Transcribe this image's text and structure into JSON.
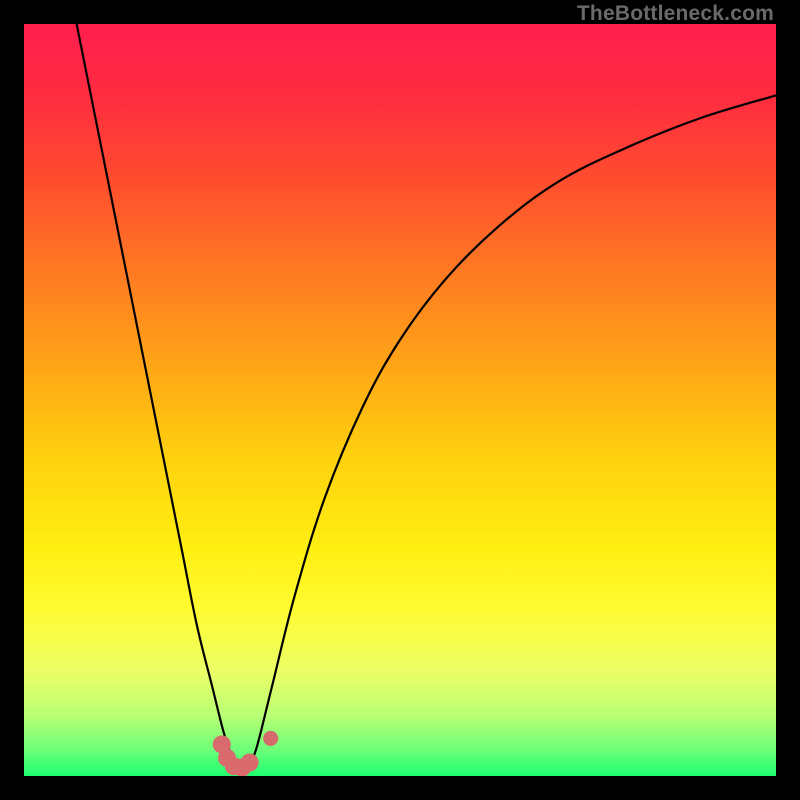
{
  "watermark": "TheBottleneck.com",
  "chart_data": {
    "type": "line",
    "title": "",
    "xlabel": "",
    "ylabel": "",
    "xlim": [
      0,
      100
    ],
    "ylim": [
      0,
      100
    ],
    "grid": false,
    "legend": false,
    "gradient_stops": [
      {
        "offset": 0.0,
        "color": "#ff1f4d"
      },
      {
        "offset": 0.09,
        "color": "#ff2b41"
      },
      {
        "offset": 0.2,
        "color": "#ff4a2f"
      },
      {
        "offset": 0.33,
        "color": "#ff7a22"
      },
      {
        "offset": 0.46,
        "color": "#ffa716"
      },
      {
        "offset": 0.58,
        "color": "#ffd20e"
      },
      {
        "offset": 0.7,
        "color": "#ffef12"
      },
      {
        "offset": 0.78,
        "color": "#fffc33"
      },
      {
        "offset": 0.86,
        "color": "#ecff66"
      },
      {
        "offset": 0.92,
        "color": "#b8ff73"
      },
      {
        "offset": 0.965,
        "color": "#6dff79"
      },
      {
        "offset": 1.0,
        "color": "#1eff70"
      }
    ],
    "series": [
      {
        "name": "left-curve",
        "stroke": "#000000",
        "points": [
          {
            "x": 7.0,
            "y": 100.0
          },
          {
            "x": 9.0,
            "y": 90.0
          },
          {
            "x": 11.0,
            "y": 80.0
          },
          {
            "x": 13.0,
            "y": 70.0
          },
          {
            "x": 15.0,
            "y": 60.0
          },
          {
            "x": 17.0,
            "y": 50.0
          },
          {
            "x": 19.0,
            "y": 40.0
          },
          {
            "x": 21.0,
            "y": 30.0
          },
          {
            "x": 23.0,
            "y": 20.0
          },
          {
            "x": 25.0,
            "y": 12.0
          },
          {
            "x": 26.5,
            "y": 6.0
          },
          {
            "x": 27.5,
            "y": 3.0
          },
          {
            "x": 28.5,
            "y": 1.5
          }
        ]
      },
      {
        "name": "right-curve",
        "stroke": "#000000",
        "points": [
          {
            "x": 30.0,
            "y": 1.5
          },
          {
            "x": 31.0,
            "y": 4.0
          },
          {
            "x": 33.0,
            "y": 12.0
          },
          {
            "x": 36.0,
            "y": 24.0
          },
          {
            "x": 40.0,
            "y": 37.0
          },
          {
            "x": 45.0,
            "y": 49.0
          },
          {
            "x": 50.0,
            "y": 58.0
          },
          {
            "x": 56.0,
            "y": 66.0
          },
          {
            "x": 63.0,
            "y": 73.0
          },
          {
            "x": 71.0,
            "y": 79.0
          },
          {
            "x": 80.0,
            "y": 83.5
          },
          {
            "x": 90.0,
            "y": 87.5
          },
          {
            "x": 100.0,
            "y": 90.5
          }
        ]
      }
    ],
    "markers": [
      {
        "name": "marker-left-1",
        "x": 26.3,
        "y": 4.2,
        "r": 1.2,
        "color": "#d96a6d"
      },
      {
        "name": "marker-left-2",
        "x": 27.0,
        "y": 2.4,
        "r": 1.2,
        "color": "#d96a6d"
      },
      {
        "name": "marker-left-3",
        "x": 27.9,
        "y": 1.3,
        "r": 1.2,
        "color": "#d96a6d"
      },
      {
        "name": "marker-left-4",
        "x": 29.0,
        "y": 1.1,
        "r": 1.2,
        "color": "#d96a6d"
      },
      {
        "name": "marker-left-5",
        "x": 30.0,
        "y": 1.8,
        "r": 1.2,
        "color": "#d96a6d"
      },
      {
        "name": "marker-right-1",
        "x": 32.8,
        "y": 5.0,
        "r": 1.0,
        "color": "#d46a6c"
      }
    ]
  }
}
